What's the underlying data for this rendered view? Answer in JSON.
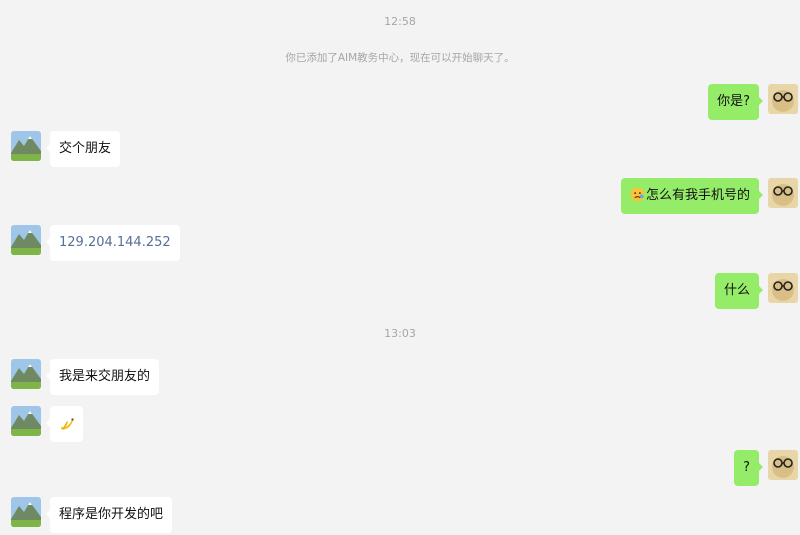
{
  "colors": {
    "background": "#f3f3f3",
    "sent_bubble": "#95ec69",
    "received_bubble": "#ffffff",
    "link": "#56709a",
    "meta_text": "#a6a6a6"
  },
  "contact": {
    "name": "AIM教务中心",
    "avatar_icon": "mountain-landscape-avatar"
  },
  "me": {
    "avatar_icon": "glasses-avatar"
  },
  "timestamps": {
    "t1": "12:58",
    "t2": "13:03"
  },
  "system_notice": "你已添加了AIM教务中心，现在可以开始聊天了。",
  "messages": [
    {
      "side": "right",
      "text": "你是?"
    },
    {
      "side": "left",
      "text": "交个朋友"
    },
    {
      "side": "right",
      "text": "怎么有我手机号的",
      "emoji": "frowning-face-emoji"
    },
    {
      "side": "left",
      "text": "129.204.144.252",
      "is_link": true
    },
    {
      "side": "right",
      "text": "什么"
    },
    {
      "side": "left",
      "text": "我是来交朋友的"
    },
    {
      "side": "left",
      "text": "",
      "emoji": "banana-emoji"
    },
    {
      "side": "right",
      "text": "?"
    },
    {
      "side": "left",
      "text": "程序是你开发的吧"
    }
  ]
}
